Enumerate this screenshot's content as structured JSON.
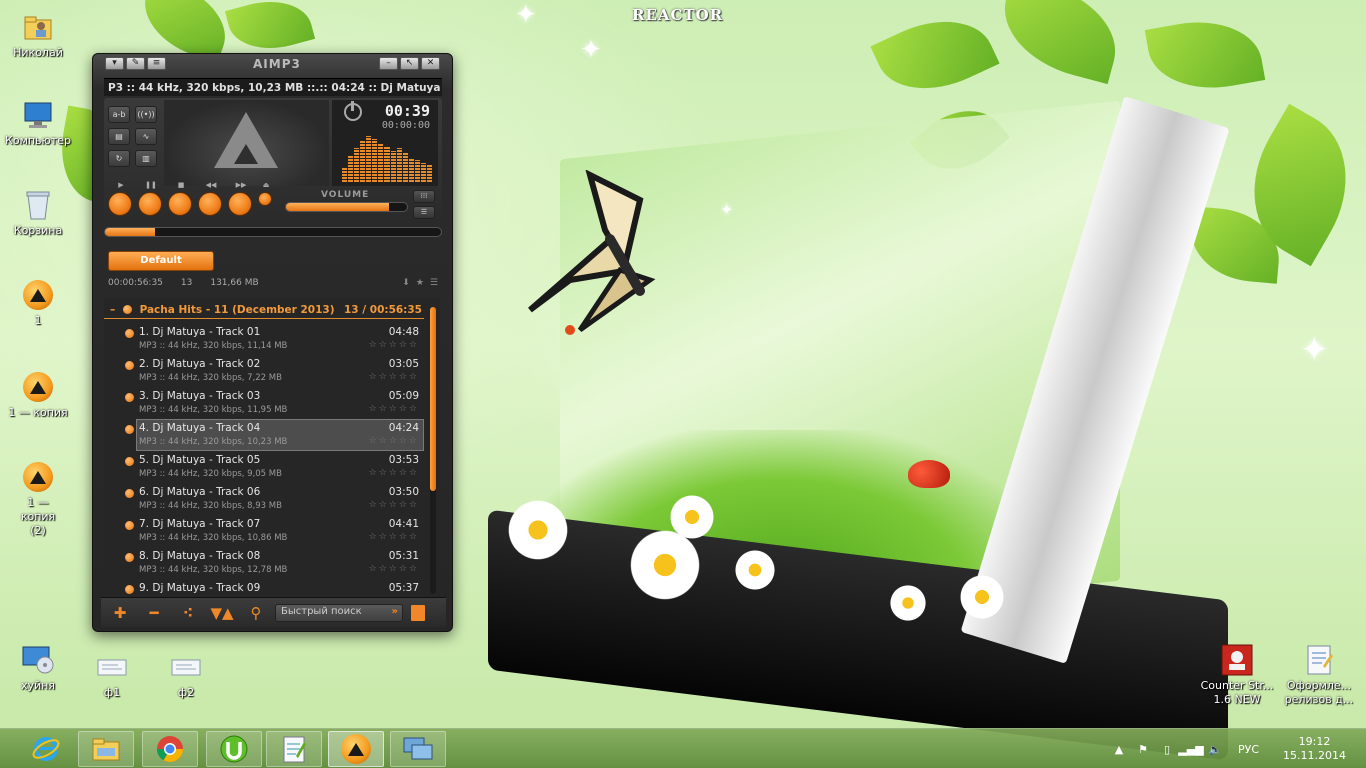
{
  "wallpaper": {
    "caption": "REACTOR"
  },
  "desktop_icons": [
    {
      "label": "Николай",
      "icon": "user-folder-icon"
    },
    {
      "label": "Компьютер",
      "icon": "computer-icon"
    },
    {
      "label": "Корзина",
      "icon": "recycle-bin-icon"
    },
    {
      "label": "1",
      "icon": "aimp-icon"
    },
    {
      "label": "1 — копия",
      "icon": "aimp-icon"
    },
    {
      "label": "1 — копия (2)",
      "icon": "aimp-icon"
    },
    {
      "label": "хуйня",
      "icon": "disc-monitor-icon"
    },
    {
      "label": "ф1",
      "icon": "file-icon"
    },
    {
      "label": "ф2",
      "icon": "file-icon"
    },
    {
      "label": "Counter Str... 1.6 NEW",
      "icon": "counter-strike-icon"
    },
    {
      "label": "Оформле... релизов д...",
      "icon": "document-icon"
    }
  ],
  "aimp": {
    "title": "AIMP3",
    "info_left": "P3 :: 44 kHz, 320 kbps, 10,23 MB ::.",
    "info_right": ":: 04:24 :: Dj Matuya",
    "time_elapsed": "00:39",
    "time_sub": "00:00:00",
    "volume_label": "VOLUME",
    "volume_level": 0.85,
    "seek_progress": 0.15,
    "playlist_tab": "Default",
    "stats": {
      "duration": "00:00:56:35",
      "count": "13",
      "size": "131,66 MB"
    },
    "group": {
      "title": "Pacha Hits - 11 (December 2013)",
      "summary": "13 / 00:56:35"
    },
    "tracks": [
      {
        "title": "1. Dj Matuya - Track 01",
        "duration": "04:48",
        "meta": "MP3 :: 44 kHz, 320 kbps, 11,14 MB",
        "active": false
      },
      {
        "title": "2. Dj Matuya - Track 02",
        "duration": "03:05",
        "meta": "MP3 :: 44 kHz, 320 kbps, 7,22 MB",
        "active": false
      },
      {
        "title": "3. Dj Matuya - Track 03",
        "duration": "05:09",
        "meta": "MP3 :: 44 kHz, 320 kbps, 11,95 MB",
        "active": false
      },
      {
        "title": "4. Dj Matuya - Track 04",
        "duration": "04:24",
        "meta": "MP3 :: 44 kHz, 320 kbps, 10,23 MB",
        "active": true
      },
      {
        "title": "5. Dj Matuya - Track 05",
        "duration": "03:53",
        "meta": "MP3 :: 44 kHz, 320 kbps, 9,05 MB",
        "active": false
      },
      {
        "title": "6. Dj Matuya - Track 06",
        "duration": "03:50",
        "meta": "MP3 :: 44 kHz, 320 kbps, 8,93 MB",
        "active": false
      },
      {
        "title": "7. Dj Matuya - Track 07",
        "duration": "04:41",
        "meta": "MP3 :: 44 kHz, 320 kbps, 10,86 MB",
        "active": false
      },
      {
        "title": "8. Dj Matuya - Track 08",
        "duration": "05:31",
        "meta": "MP3 :: 44 kHz, 320 kbps, 12,78 MB",
        "active": false
      },
      {
        "title": "9. Dj Matuya - Track 09",
        "duration": "05:37",
        "meta": "",
        "active": false
      }
    ],
    "search_placeholder": "Быстрый поиск"
  },
  "taskbar": {
    "apps": [
      "internet-explorer-icon",
      "file-explorer-icon",
      "chrome-icon",
      "utorrent-icon",
      "notepad-icon",
      "aimp-icon",
      "remote-desktop-icon"
    ],
    "language": "РУС",
    "time": "19:12",
    "date": "15.11.2014"
  }
}
